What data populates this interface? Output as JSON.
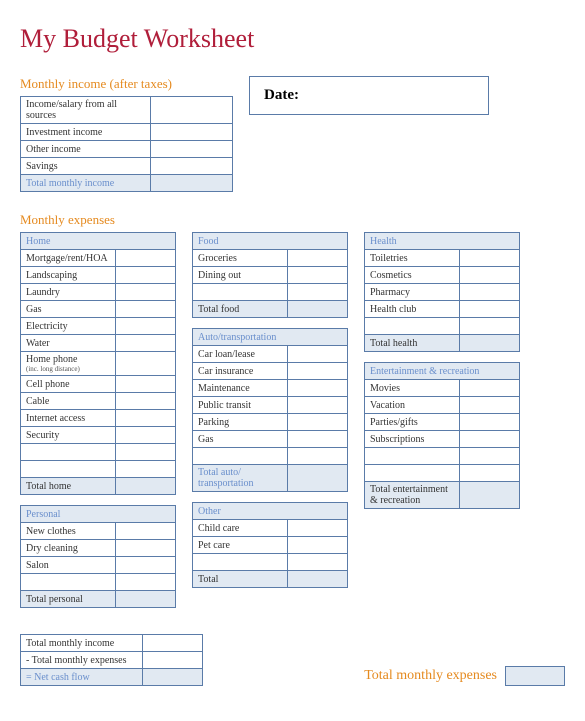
{
  "title": "My Budget Worksheet",
  "income_section": "Monthly income (after taxes)",
  "income_rows": [
    "Income/salary from all sources",
    "Investment income",
    "Other income",
    "Savings"
  ],
  "income_total": "Total monthly income",
  "date_label": "Date:",
  "expenses_section": "Monthly expenses",
  "cats": {
    "home": {
      "header": "Home",
      "rows": [
        "Mortgage/rent/HOA",
        "Landscaping",
        "Laundry",
        "Gas",
        "Electricity",
        "Water",
        "Home phone",
        "Cell phone",
        "Cable",
        "Internet access",
        "Security",
        "",
        ""
      ],
      "note": "(inc. long distance)",
      "total": "Total home"
    },
    "personal": {
      "header": "Personal",
      "rows": [
        "New clothes",
        "Dry cleaning",
        "Salon",
        ""
      ],
      "total": "Total personal"
    },
    "food": {
      "header": "Food",
      "rows": [
        "Groceries",
        "Dining out",
        ""
      ],
      "total": "Total food"
    },
    "auto": {
      "header": "Auto/transportation",
      "rows": [
        "Car loan/lease",
        "Car insurance",
        "Maintenance",
        "Public transit",
        "Parking",
        "Gas",
        ""
      ],
      "total": "Total auto/ transportation"
    },
    "other": {
      "header": "Other",
      "rows": [
        "Child care",
        "Pet care",
        ""
      ],
      "total": "Total"
    },
    "health": {
      "header": "Health",
      "rows": [
        "Toiletries",
        "Cosmetics",
        "Pharmacy",
        "Health club",
        ""
      ],
      "total": "Total health"
    },
    "entertainment": {
      "header": "Entertainment & recreation",
      "rows": [
        "Movies",
        "Vacation",
        "Parties/gifts",
        "Subscriptions",
        "",
        ""
      ],
      "total": "Total entertainment & recreation"
    }
  },
  "summary": {
    "income": "Total monthly income",
    "expenses": "- Total monthly expenses",
    "net": "= Net cash flow"
  },
  "grand_total": "Total monthly expenses"
}
